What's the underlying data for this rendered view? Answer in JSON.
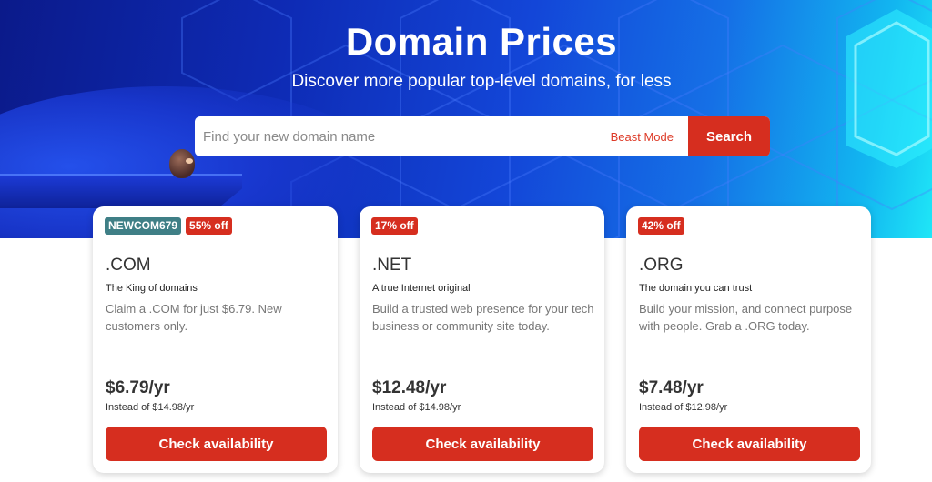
{
  "hero": {
    "title": "Domain Prices",
    "subtitle": "Discover more popular top-level domains, for less"
  },
  "search": {
    "placeholder": "Find your new domain name",
    "beast_mode_label": "Beast Mode",
    "button_label": "Search"
  },
  "colors": {
    "accent_red": "#d62e1f",
    "promo_teal": "#3f7f86",
    "hero_blue": "#0e2bb5"
  },
  "cards": [
    {
      "promo_code": "NEWCOM679",
      "discount": "55% off",
      "tld": ".COM",
      "tagline": "The King of domains",
      "description": "Claim a .COM for just $6.79. New customers only.",
      "price": "$6.79/yr",
      "instead": "Instead of $14.98/yr",
      "button_label": "Check availability"
    },
    {
      "discount": "17% off",
      "tld": ".NET",
      "tagline": "A true Internet original",
      "description": "Build a trusted web presence for your tech business or community site today.",
      "price": "$12.48/yr",
      "instead": "Instead of $14.98/yr",
      "button_label": "Check availability"
    },
    {
      "discount": "42% off",
      "tld": ".ORG",
      "tagline": "The domain you can trust",
      "description": "Build your mission, and connect purpose with people. Grab a .ORG today.",
      "price": "$7.48/yr",
      "instead": "Instead of $12.98/yr",
      "button_label": "Check availability"
    }
  ]
}
